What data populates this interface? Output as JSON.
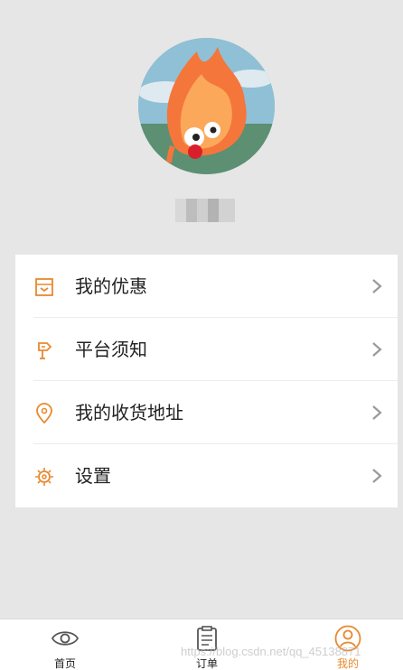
{
  "profile": {
    "avatar_name": "avatar",
    "username": "■■■■"
  },
  "menu": {
    "items": [
      {
        "label": "我的优惠",
        "icon": "coupon-icon"
      },
      {
        "label": "平台须知",
        "icon": "signpost-icon"
      },
      {
        "label": "我的收货地址",
        "icon": "location-pin-icon"
      },
      {
        "label": "设置",
        "icon": "settings-gear-icon"
      }
    ]
  },
  "tabbar": {
    "tabs": [
      {
        "label": "首页",
        "icon": "eye-icon",
        "active": false
      },
      {
        "label": "订单",
        "icon": "clipboard-icon",
        "active": false
      },
      {
        "label": "我的",
        "icon": "user-circle-icon",
        "active": true
      }
    ]
  },
  "watermark": "https://blog.csdn.net/qq_45138871",
  "colors": {
    "accent": "#e8892f",
    "background": "#e6e6e6",
    "card": "#ffffff"
  }
}
